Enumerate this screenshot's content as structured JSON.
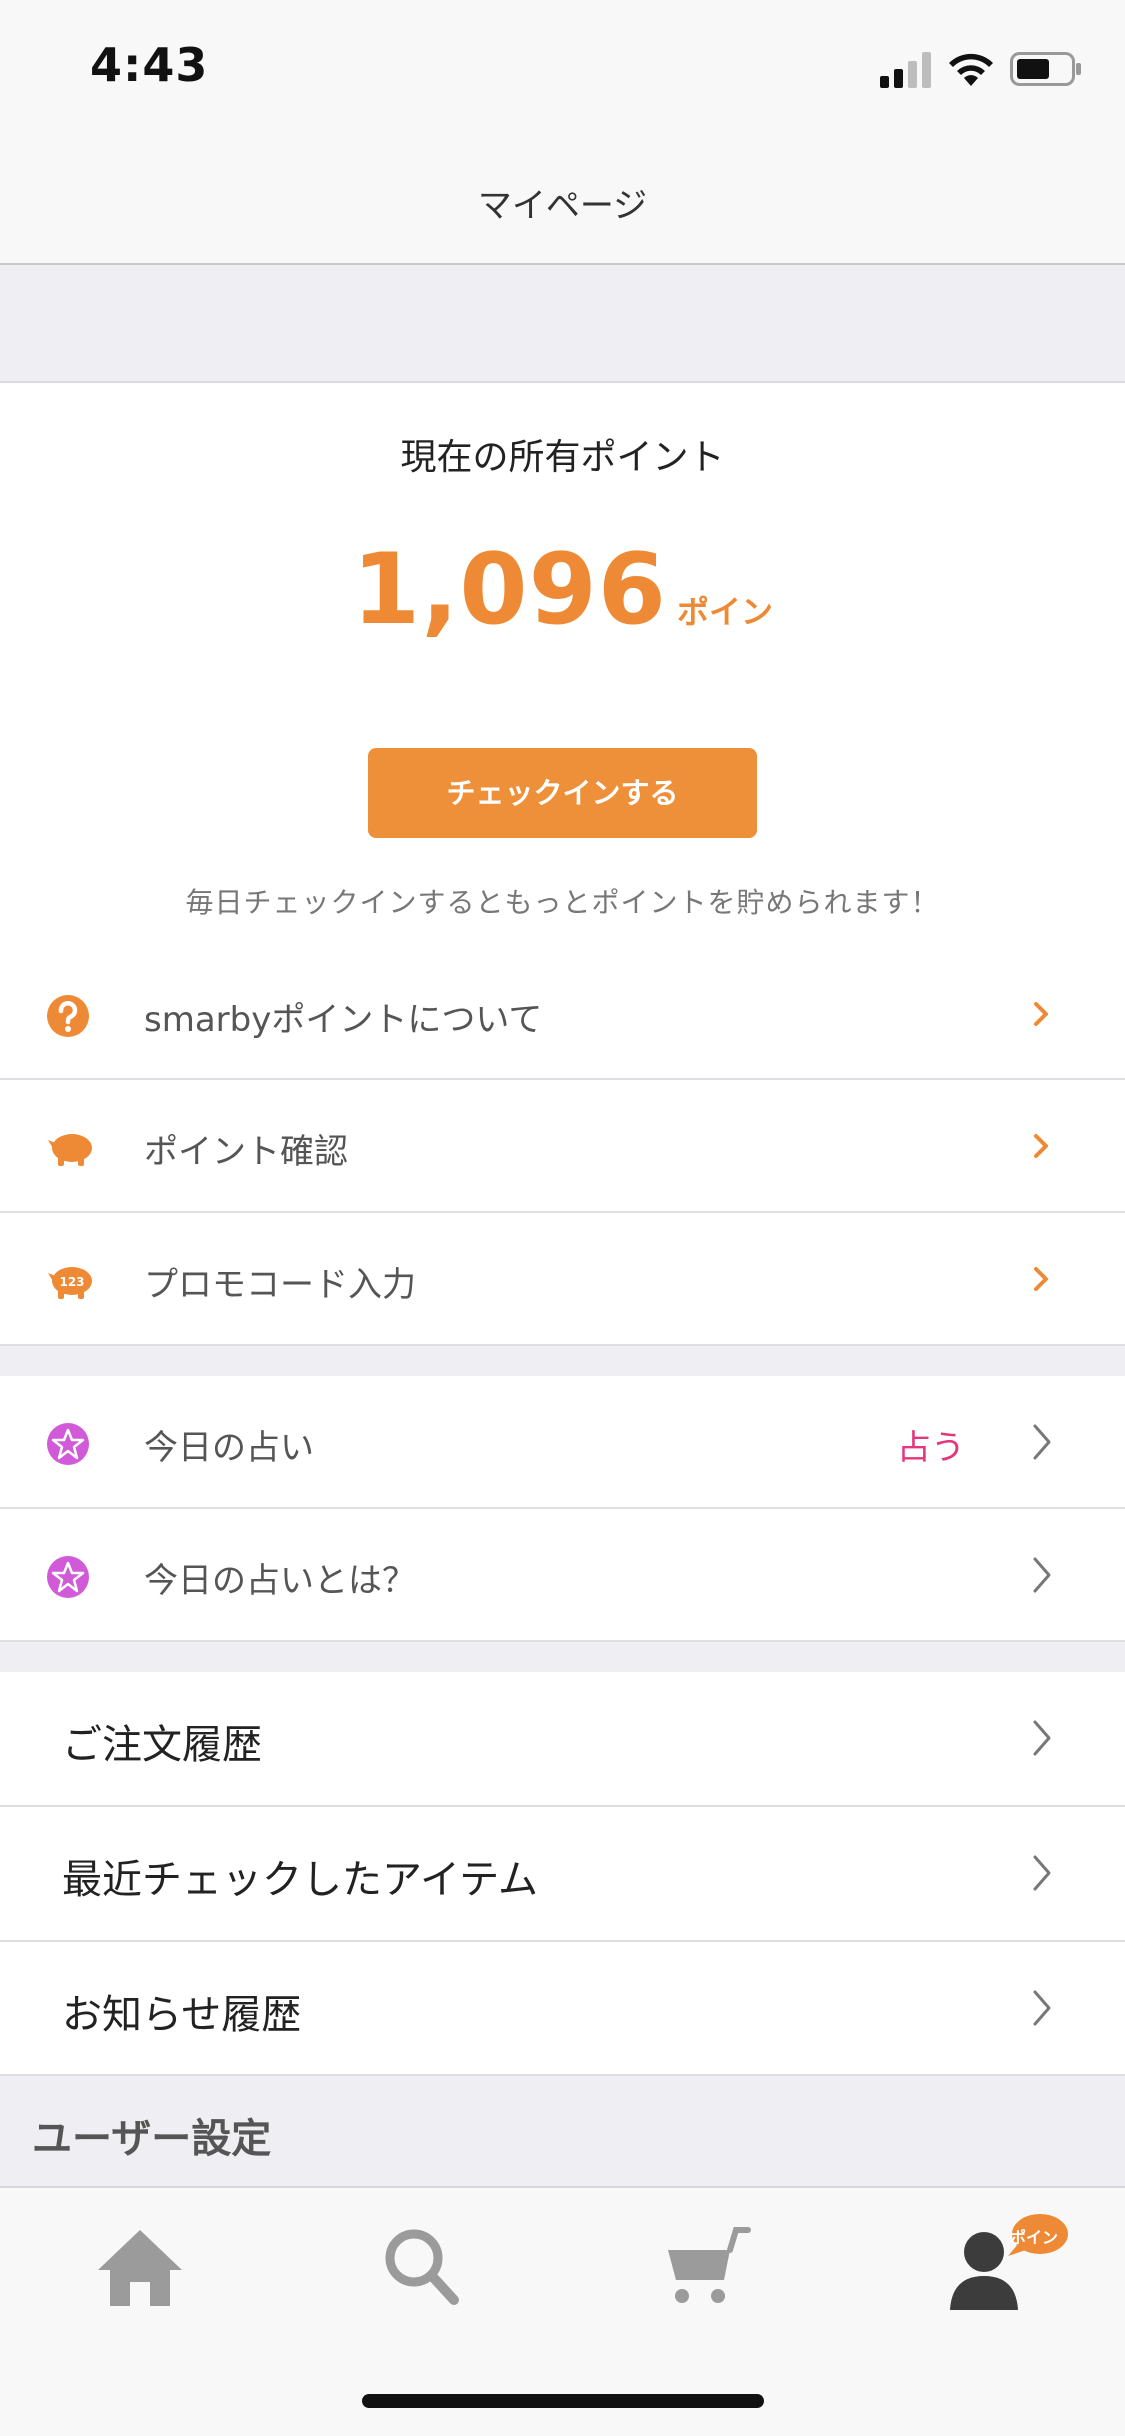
{
  "status_bar": {
    "time": "4:43",
    "signal_icon": "cellular-signal-icon",
    "wifi_icon": "wifi-icon",
    "battery_icon": "battery-icon"
  },
  "nav": {
    "title": "マイページ"
  },
  "points": {
    "label": "現在の所有ポイント",
    "value": "1,096",
    "unit": "ポイン",
    "checkin_label": "チェックインする",
    "hint": "毎日チェックインするともっとポイントを貯められます！"
  },
  "point_menu": [
    {
      "label": "smarbyポイントについて",
      "icon": "question-icon"
    },
    {
      "label": "ポイント確認",
      "icon": "piggy-bank-icon"
    },
    {
      "label": "プロモコード入力",
      "icon": "piggy-bank-123-icon"
    }
  ],
  "fortune_menu": [
    {
      "label": "今日の占い",
      "extra": "占う",
      "icon": "star-icon"
    },
    {
      "label": "今日の占いとは？",
      "icon": "star-icon"
    }
  ],
  "history_menu": [
    {
      "label": "ご注文履歴"
    },
    {
      "label": "最近チェックしたアイテム"
    },
    {
      "label": "お知らせ履歴"
    }
  ],
  "user_settings": {
    "title": "ユーザー設定"
  },
  "tabbar": {
    "items": [
      "home-icon",
      "search-icon",
      "cart-icon",
      "user-icon"
    ],
    "badge_text": "ポイン"
  },
  "colors": {
    "accent": "#ee8f3a",
    "fortune_pink": "#e4367c",
    "star_purple": "#d05ad8"
  }
}
